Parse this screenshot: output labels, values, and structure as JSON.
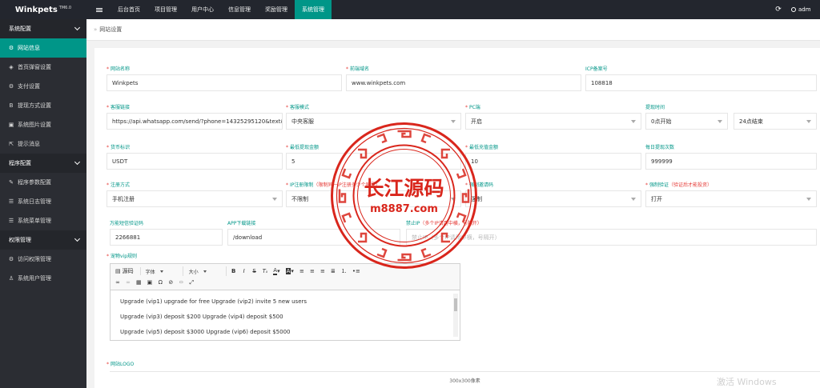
{
  "app": {
    "name": "Winkpets",
    "version": "TM6.0"
  },
  "topnav": {
    "items": [
      "后台首页",
      "项目管理",
      "用户中心",
      "信息管理",
      "奖励管理",
      "系统管理"
    ],
    "active_index": 5,
    "user": "adm"
  },
  "sidebar": {
    "groups": [
      {
        "label": "系统配置",
        "items": [
          {
            "label": "网站信息",
            "icon": "gear-icon",
            "active": true
          },
          {
            "label": "首页弹窗设置",
            "icon": "tag-icon"
          },
          {
            "label": "支付设置",
            "icon": "gear-icon"
          },
          {
            "label": "提现方式设置",
            "icon": "bitcoin-icon"
          },
          {
            "label": "系统图片设置",
            "icon": "image-icon"
          },
          {
            "label": "提示消息",
            "icon": "export-icon"
          }
        ]
      },
      {
        "label": "程序配置",
        "items": [
          {
            "label": "程序参数配置",
            "icon": "wrench-icon"
          },
          {
            "label": "系统日志管理",
            "icon": "list-icon"
          },
          {
            "label": "系统菜单管理",
            "icon": "list-icon"
          }
        ]
      },
      {
        "label": "权限管理",
        "items": [
          {
            "label": "访问权限管理",
            "icon": "gear-icon"
          },
          {
            "label": "系统用户管理",
            "icon": "user-icon"
          }
        ]
      }
    ]
  },
  "breadcrumb": {
    "text": "网站设置"
  },
  "form": {
    "site_name": {
      "label": "网站名称",
      "value": "Winkpets"
    },
    "frontend_domain": {
      "label": "前端域名",
      "value": "www.winkpets.com"
    },
    "icp": {
      "label": "ICP备案号",
      "value": "108818"
    },
    "cs_link": {
      "label": "客服链接",
      "value": "https://api.whatsapp.com/send/?phone=14325295120&text&type"
    },
    "cs_mode": {
      "label": "客服模式",
      "value": "中央客服"
    },
    "pc_end": {
      "label": "PC端",
      "value": "开启"
    },
    "withdraw_time": {
      "label": "提现时间",
      "start": "0点开始",
      "end": "24点结束"
    },
    "currency": {
      "label": "货币标识",
      "value": "USDT"
    },
    "min_withdraw": {
      "label": "最低提现金额",
      "value": "5"
    },
    "min_recharge": {
      "label": "最低充值金额",
      "value": "10"
    },
    "daily_withdraw": {
      "label": "每日提现次数",
      "value": "999999"
    },
    "register_mode": {
      "label": "注册方式",
      "value": "手机注册"
    },
    "ip_limit": {
      "label": "IP注册限制",
      "hint": "（限制同一IP注册多少个账号）",
      "value": "不限制"
    },
    "invite_code": {
      "label": "强制邀请码",
      "value": "强制"
    },
    "force_verify": {
      "label": "强制验证",
      "hint": "（验证后才能投资）",
      "value": "打开"
    },
    "universal_sms": {
      "label": "万能短信验证码",
      "value": "2266881"
    },
    "app_download": {
      "label": "APP下载链接",
      "value": "/download"
    },
    "ban_ip": {
      "label": "禁止IP",
      "hint": "（多个IP请用中横，号隔开）",
      "placeholder": "禁止IP（多个IP请用中横，号隔开）"
    },
    "vip_rules": {
      "label": "宠物vip规则",
      "toolbar": {
        "source": "源码",
        "font": "字体",
        "size": "大小"
      },
      "lines": [
        "Upgrade (vip1) upgrade for free Upgrade (vip2) invite 5 new users",
        "Upgrade (vip3) deposit $200 Upgrade (vip4) deposit $500",
        "Upgrade (vip5) deposit $3000 Upgrade (vip6) deposit $5000"
      ]
    },
    "site_logo": {
      "label": "网站LOGO",
      "size_hint": "300x300像素"
    }
  },
  "watermark": {
    "brand": "长江源码",
    "url": "m8887.com"
  },
  "os_overlay": {
    "text": "激活 Windows"
  },
  "colors": {
    "accent": "#009688",
    "topbar": "#23262e",
    "sidebar": "#2b2d33",
    "required": "#e53935",
    "seal": "#d9261c"
  }
}
